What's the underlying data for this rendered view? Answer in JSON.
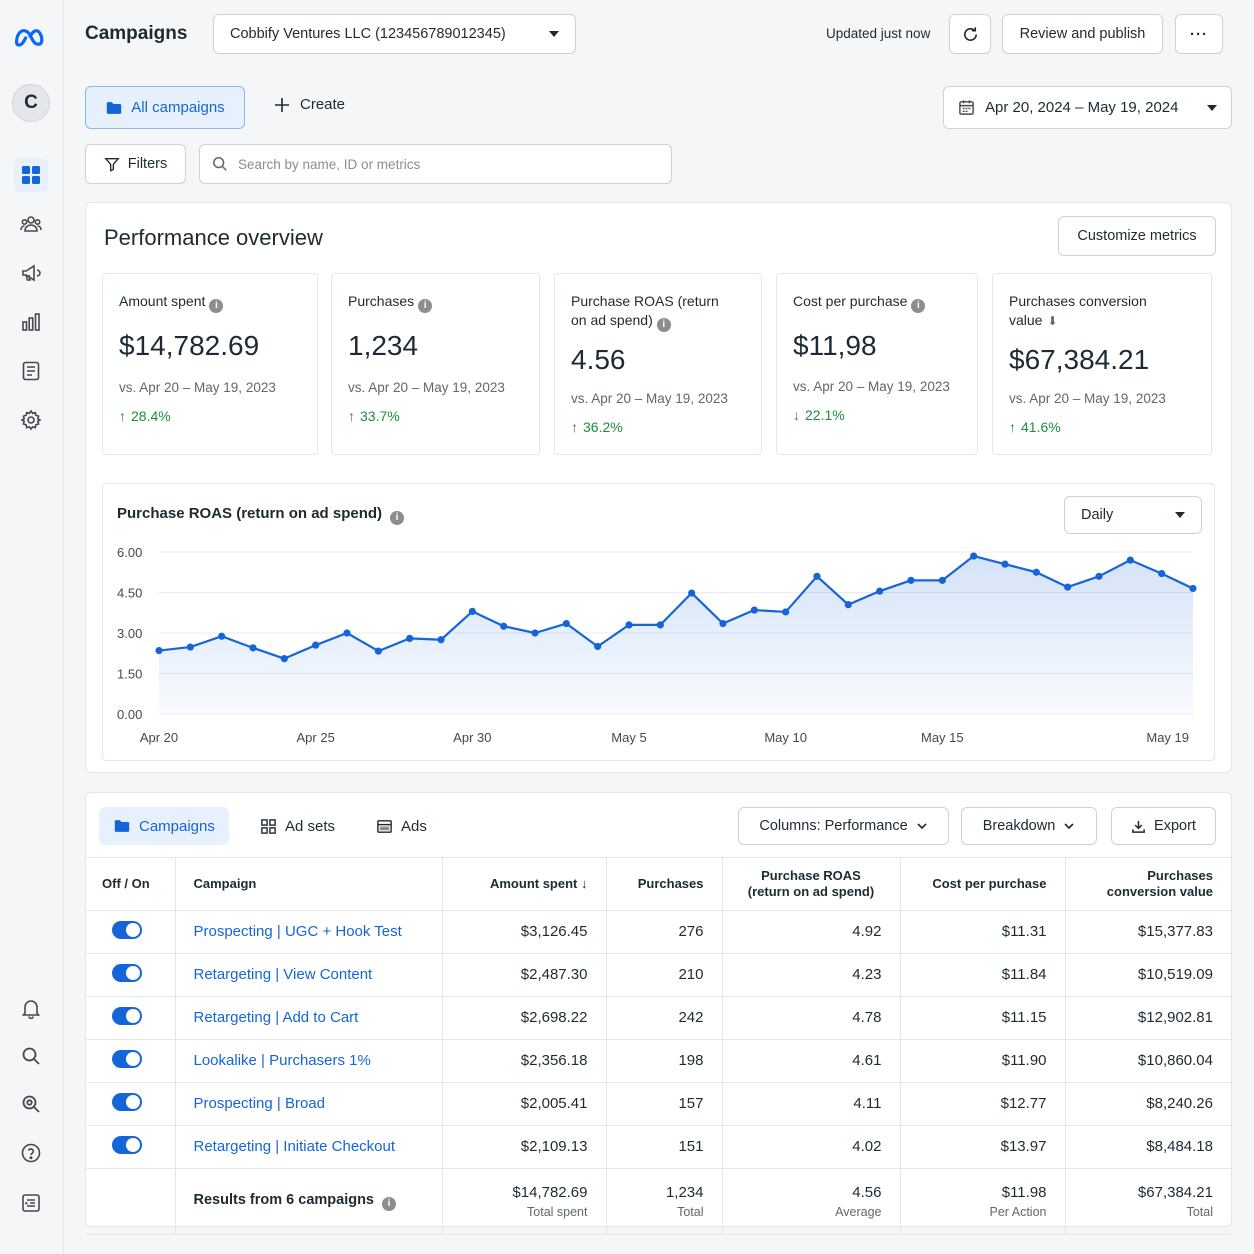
{
  "header": {
    "title": "Campaigns",
    "account": "Cobbify Ventures LLC (123456789012345)",
    "updated": "Updated just now",
    "review_publish": "Review and publish",
    "more": "···"
  },
  "sidebar": {
    "avatar": "C",
    "brand_color": "#0866ff"
  },
  "toolbar": {
    "all_campaigns": "All campaigns",
    "create": "Create",
    "date_range": "Apr 20, 2024 – May 19, 2024",
    "filters": "Filters",
    "search_placeholder": "Search by name, ID or metrics"
  },
  "overview": {
    "title": "Performance overview",
    "customize": "Customize metrics",
    "kpis": [
      {
        "label": "Amount spent",
        "value": "$14,782.69",
        "compare": "vs. Apr 20 – May 19, 2023",
        "change": "28.4%",
        "direction": "up"
      },
      {
        "label": "Purchases",
        "value": "1,234",
        "compare": "vs. Apr 20 – May 19, 2023",
        "change": "33.7%",
        "direction": "up"
      },
      {
        "label": "Purchase ROAS (return on ad spend)",
        "value": "4.56",
        "compare": "vs. Apr 20 – May 19, 2023",
        "change": "36.2%",
        "direction": "up"
      },
      {
        "label": "Cost per purchase",
        "value": "$11,98",
        "compare": "vs. Apr 20 – May 19, 2023",
        "change": "22.1%",
        "direction": "down"
      },
      {
        "label": "Purchases conversion value",
        "value": "$67,384.21",
        "compare": "vs. Apr 20 – May 19, 2023",
        "change": "41.6%",
        "direction": "up"
      }
    ]
  },
  "chart_data": {
    "type": "line",
    "title": "Purchase ROAS (return on ad spend)",
    "interval": "Daily",
    "ylim": [
      0,
      6
    ],
    "yticks": [
      "6.00",
      "4.50",
      "3.00",
      "1.50",
      "0.00"
    ],
    "xticks": [
      "Apr 20",
      "Apr 25",
      "Apr 30",
      "May 5",
      "May 10",
      "May 15",
      "May 19"
    ],
    "x": [
      "Apr 20",
      "Apr 21",
      "Apr 22",
      "Apr 23",
      "Apr 24",
      "Apr 25",
      "Apr 26",
      "Apr 27",
      "Apr 28",
      "Apr 29",
      "Apr 30",
      "May 1",
      "May 2",
      "May 3",
      "May 4",
      "May 5",
      "May 6",
      "May 7",
      "May 8",
      "May 9",
      "May 10",
      "May 11",
      "May 12",
      "May 13",
      "May 14",
      "May 15",
      "May 16",
      "May 17",
      "May 18",
      "May 19",
      "May 20",
      "May 21",
      "May 22",
      "May 23"
    ],
    "values": [
      2.35,
      2.48,
      2.88,
      2.45,
      2.05,
      2.55,
      3.0,
      2.33,
      2.8,
      2.75,
      3.8,
      3.25,
      3.0,
      3.35,
      2.5,
      3.3,
      3.3,
      4.48,
      3.35,
      3.85,
      3.78,
      5.1,
      4.05,
      4.55,
      4.95,
      4.95,
      5.85,
      5.55,
      5.25,
      4.7,
      5.1,
      5.7,
      5.2,
      4.65
    ],
    "grid": true,
    "line_color": "#1565d8"
  },
  "tables": {
    "tabs": [
      "Campaigns",
      "Ad sets",
      "Ads"
    ],
    "columns_btn": "Columns: Performance",
    "breakdown": "Breakdown",
    "export": "Export",
    "headers": [
      "Off / On",
      "Campaign",
      "Amount spent",
      "Purchases",
      "Purchase ROAS\n(return on ad spend)",
      "Cost per purchase",
      "Purchases\nconversion value"
    ],
    "rows": [
      {
        "name": "Prospecting | UGC + Hook Test",
        "spent": "$3,126.45",
        "purchases": "276",
        "roas": "4.92",
        "cpp": "$11.31",
        "value": "$15,377.83"
      },
      {
        "name": "Retargeting | View Content",
        "spent": "$2,487.30",
        "purchases": "210",
        "roas": "4.23",
        "cpp": "$11.84",
        "value": "$10,519.09"
      },
      {
        "name": "Retargeting | Add to Cart",
        "spent": "$2,698.22",
        "purchases": "242",
        "roas": "4.78",
        "cpp": "$11.15",
        "value": "$12,902.81"
      },
      {
        "name": "Lookalike | Purchasers 1%",
        "spent": "$2,356.18",
        "purchases": "198",
        "roas": "4.61",
        "cpp": "$11.90",
        "value": "$10,860.04"
      },
      {
        "name": "Prospecting | Broad",
        "spent": "$2,005.41",
        "purchases": "157",
        "roas": "4.11",
        "cpp": "$12.77",
        "value": "$8,240.26"
      },
      {
        "name": "Retargeting | Initiate Checkout",
        "spent": "$2,109.13",
        "purchases": "151",
        "roas": "4.02",
        "cpp": "$13.97",
        "value": "$8,484.18"
      }
    ],
    "summary": {
      "label": "Results from 6 campaigns",
      "spent": "$14,782.69",
      "spent_sub": "Total spent",
      "purchases": "1,234",
      "purchases_sub": "Total",
      "roas": "4.56",
      "roas_sub": "Average",
      "cpp": "$11.98",
      "cpp_sub": "Per Action",
      "value": "$67,384.21",
      "value_sub": "Total"
    }
  }
}
